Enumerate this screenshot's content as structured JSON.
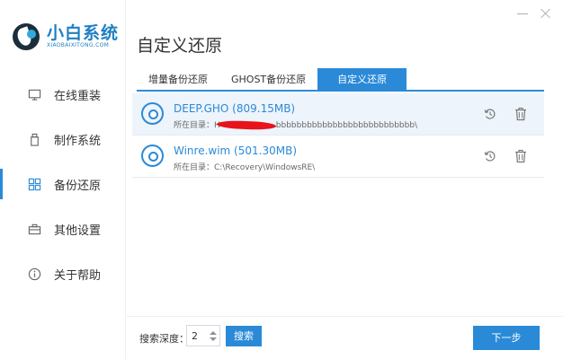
{
  "window": {
    "minimize_icon": "minimize-icon",
    "close_icon": "close-icon"
  },
  "brand": {
    "title": "小白系统",
    "subtitle": "XIAOBAIXITONG.COM"
  },
  "sidebar": {
    "items": [
      {
        "label": "在线重装",
        "icon": "monitor-icon",
        "active": false
      },
      {
        "label": "制作系统",
        "icon": "usb-drive-icon",
        "active": false
      },
      {
        "label": "备份还原",
        "icon": "grid-icon",
        "active": true
      },
      {
        "label": "其他设置",
        "icon": "briefcase-icon",
        "active": false
      },
      {
        "label": "关于帮助",
        "icon": "info-icon",
        "active": false
      }
    ]
  },
  "main": {
    "title": "自定义还原",
    "tabs": [
      {
        "label": "增量备份还原",
        "active": false
      },
      {
        "label": "GHOST备份还原",
        "active": false
      },
      {
        "label": "自定义还原",
        "active": true
      }
    ],
    "files": [
      {
        "name": "DEEP.GHO (809.15MB)",
        "path_label": "所在目录：",
        "path_prefix": "H",
        "path": "bbbbbbbbbbbbbbbbbbbbbbbbbbb\\",
        "redacted": true,
        "selected": true
      },
      {
        "name": "Winre.wim (501.30MB)",
        "path_label": "所在目录：",
        "path_prefix": "",
        "path": "C:\\Recovery\\WindowsRE\\",
        "redacted": false,
        "selected": false
      }
    ]
  },
  "footer": {
    "depth_label": "搜索深度：",
    "depth_value": "2",
    "search_label": "搜索",
    "next_label": "下一步"
  },
  "colors": {
    "accent": "#2a8ad8",
    "brand": "#1f7fc4",
    "redaction": "#e8131b"
  }
}
